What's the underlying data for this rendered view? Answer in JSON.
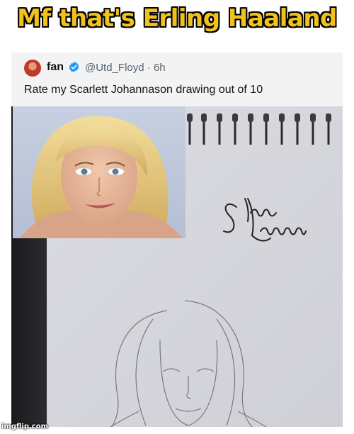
{
  "meme": {
    "caption": "Mf that's Erling Haaland",
    "watermark": "imgflip.com"
  },
  "tweet": {
    "display_name": "fan",
    "handle": "@Utd_Floyd",
    "separator": "·",
    "time": "6h",
    "text": "Rate my Scarlett Johannason drawing out of 10",
    "verified_icon": "verified-badge-icon",
    "verified_color": "#1d9bf0"
  },
  "images": {
    "sketch_signature": "Scarlett Johannson"
  }
}
